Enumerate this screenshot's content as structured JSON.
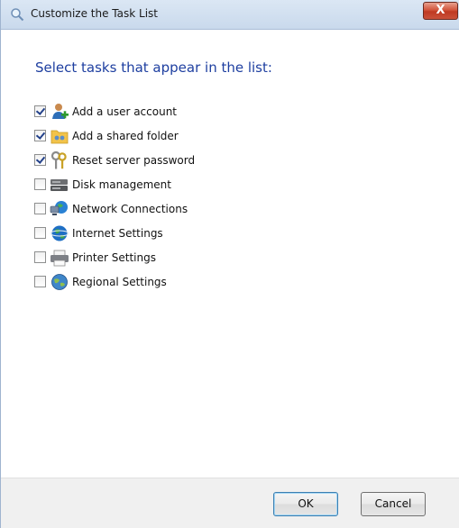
{
  "window": {
    "title": "Customize the Task List",
    "close_label": "X"
  },
  "heading": "Select tasks that appear in the list:",
  "tasks": [
    {
      "label": "Add a user account",
      "checked": true,
      "icon": "user-icon"
    },
    {
      "label": "Add a shared folder",
      "checked": true,
      "icon": "shared-folder-icon"
    },
    {
      "label": "Reset server password",
      "checked": true,
      "icon": "keys-icon"
    },
    {
      "label": "Disk management",
      "checked": false,
      "icon": "disk-icon"
    },
    {
      "label": "Network Connections",
      "checked": false,
      "icon": "network-icon"
    },
    {
      "label": "Internet Settings",
      "checked": false,
      "icon": "globe-icon"
    },
    {
      "label": "Printer Settings",
      "checked": false,
      "icon": "printer-icon"
    },
    {
      "label": "Regional Settings",
      "checked": false,
      "icon": "regional-globe-icon"
    }
  ],
  "buttons": {
    "ok_label": "OK",
    "cancel_label": "Cancel"
  },
  "colors": {
    "heading": "#1e3fa0",
    "close_button": "#c9513a",
    "footer": "#f0f0f0"
  }
}
